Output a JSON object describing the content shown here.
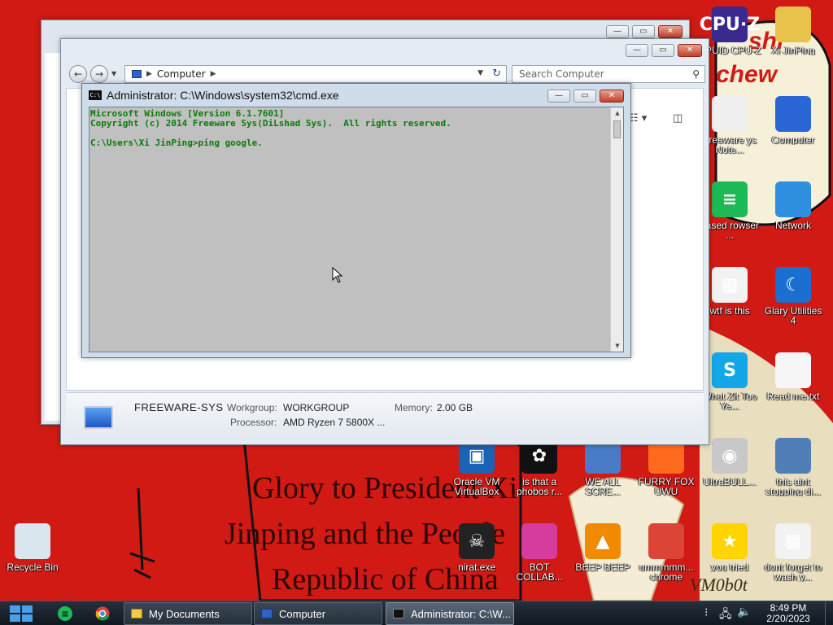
{
  "wallpaper": {
    "text_line1": "Glory to President Xi",
    "text_line2": "Jinping and the People",
    "text_line3": "Republic of China",
    "corner_text_top": "shi",
    "corner_text_mid": "chew",
    "signature": "VM0b0t"
  },
  "desktop_icons": [
    {
      "name": "cpuid-icon",
      "label": "CPUID CPU-Z",
      "badge": "CPU·Z",
      "color": "#3a2a8f"
    },
    {
      "name": "xijinping-icon",
      "label": "Xi JinPing",
      "badge": "",
      "color": "#e9c24b"
    },
    {
      "name": "freeware-notes-icon",
      "label": "Freeware ys Note...",
      "badge": "",
      "color": "#f0f0f0"
    },
    {
      "name": "computer-icon",
      "label": "Computer",
      "badge": "",
      "color": "#2a66d6"
    },
    {
      "name": "browser-icon",
      "label": "based rowser ...",
      "badge": "≡",
      "color": "#1db954"
    },
    {
      "name": "network-icon",
      "label": "Network",
      "badge": "",
      "color": "#2e8fe0"
    },
    {
      "name": "wtf-icon",
      "label": "wtf is this",
      "badge": "▦",
      "color": "#f2f2f2"
    },
    {
      "name": "glary-icon",
      "label": "Glary Utilities 4",
      "badge": "☾",
      "color": "#1a6fd1"
    },
    {
      "name": "skype-icon",
      "label": "What Zit Too Ye...",
      "badge": "S",
      "color": "#13a7e8"
    },
    {
      "name": "readme-icon",
      "label": "Read me.txt",
      "badge": "",
      "color": "#f6f6f6"
    },
    {
      "name": "virtualbox-icon",
      "label": "Oracle VM VirtualBox",
      "badge": "▣",
      "color": "#1d63b5"
    },
    {
      "name": "phobos-icon",
      "label": "is that a phobos r...",
      "badge": "✿",
      "color": "#111"
    },
    {
      "name": "we-all-icon",
      "label": "WE ALL SCRE...",
      "badge": "",
      "color": "#4a7bc8"
    },
    {
      "name": "firefox-icon",
      "label": "FURRY FOX UWU",
      "badge": "",
      "color": "#ff6a1f"
    },
    {
      "name": "ultrabull-icon",
      "label": "UltraBULL...",
      "badge": "◉",
      "color": "#c8c8c8"
    },
    {
      "name": "this-aint-icon",
      "label": "this aint stopping di...",
      "badge": "",
      "color": "#4f7fb6"
    },
    {
      "name": "recycle-bin-icon",
      "label": "Recycle Bin",
      "badge": "",
      "color": "#d9e6ee"
    },
    {
      "name": "nirat-icon",
      "label": "nirat.exe",
      "badge": "☠",
      "color": "#222"
    },
    {
      "name": "bot-collab-icon",
      "label": "BOT COLLAB...",
      "badge": "",
      "color": "#d63c9e"
    },
    {
      "name": "vlc-icon",
      "label": "BEEP BEEP",
      "badge": "▲",
      "color": "#f08a00"
    },
    {
      "name": "chrome-icon",
      "label": "ummmmm... chrome",
      "badge": "",
      "color": "#db4437"
    },
    {
      "name": "star-icon",
      "label": "you tried",
      "badge": "★",
      "color": "#ffd400"
    },
    {
      "name": "dont-forget-icon",
      "label": "dont forget to wash y...",
      "badge": "▦",
      "color": "#f2f2f2"
    }
  ],
  "explorer": {
    "breadcrumb": "Computer",
    "search_placeholder": "Search Computer",
    "computer_name": "FREEWARE-SYS",
    "workgroup_label": "Workgroup:",
    "workgroup_value": "WORKGROUP",
    "memory_label": "Memory:",
    "memory_value": "2.00 GB",
    "processor_label": "Processor:",
    "processor_value": "AMD Ryzen 7 5800X ..."
  },
  "cmd": {
    "title": "Administrator: C:\\Windows\\system32\\cmd.exe",
    "lines": [
      "Microsoft Windows [Version 6.1.7601]",
      "Copyright (c) 2014 Freeware Sys(DiLshad Sys).  All rights reserved.",
      "",
      "C:\\Users\\Xi JinPing>ping google."
    ]
  },
  "taskbar": {
    "tasks": [
      {
        "label": "My Documents",
        "icon": "folder-icon",
        "active": false
      },
      {
        "label": "Computer",
        "icon": "computer-icon",
        "active": false
      },
      {
        "label": "Administrator: C:\\W...",
        "icon": "cmd-icon",
        "active": true
      }
    ],
    "time": "8:49 PM",
    "date": "2/20/2023"
  }
}
